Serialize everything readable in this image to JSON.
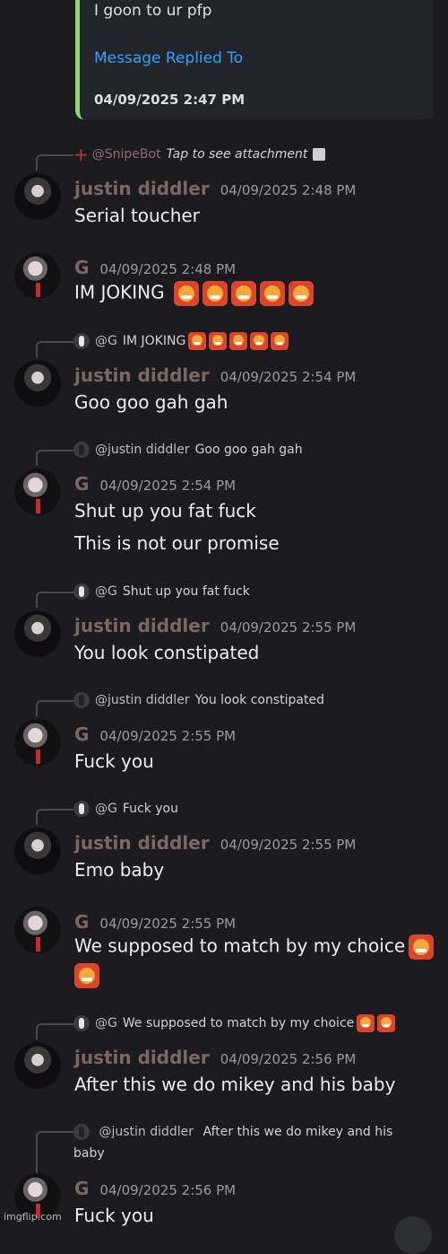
{
  "embed": {
    "text": "I goon to ur pfp",
    "link": "Message Replied To",
    "date": "04/09/2025 2:47 PM"
  },
  "messages": [
    {
      "reply": {
        "name": "@SnipeBot",
        "text": "Tap to see attachment"
      },
      "author": "justin diddler",
      "time": "04/09/2025 2:48 PM",
      "lines": [
        "Serial toucher"
      ]
    },
    {
      "author": "G",
      "time": "04/09/2025 2:48 PM",
      "lines": [
        "IM JOKING"
      ]
    },
    {
      "reply": {
        "name": "@G",
        "text": "IM JOKING"
      },
      "author": "justin diddler",
      "time": "04/09/2025 2:54 PM",
      "lines": [
        "Goo goo gah gah"
      ]
    },
    {
      "reply": {
        "name": "@justin diddler",
        "text": "Goo goo gah gah"
      },
      "author": "G",
      "time": "04/09/2025 2:54 PM",
      "lines": [
        "Shut up you fat fuck",
        "This is not our promise"
      ]
    },
    {
      "reply": {
        "name": "@G",
        "text": "Shut up you fat fuck"
      },
      "author": "justin diddler",
      "time": "04/09/2025 2:55 PM",
      "lines": [
        "You look constipated"
      ]
    },
    {
      "reply": {
        "name": "@justin diddler",
        "text": "You look constipated"
      },
      "author": "G",
      "time": "04/09/2025 2:55 PM",
      "lines": [
        "Fuck you"
      ]
    },
    {
      "reply": {
        "name": "@G",
        "text": "Fuck you"
      },
      "author": "justin diddler",
      "time": "04/09/2025 2:55 PM",
      "lines": [
        "Emo baby"
      ]
    },
    {
      "author": "G",
      "time": "04/09/2025 2:55 PM",
      "lines": [
        "We supposed to match by my choice"
      ]
    },
    {
      "reply": {
        "name": "@G",
        "text": "We supposed to match by my choice"
      },
      "author": "justin diddler",
      "time": "04/09/2025 2:56 PM",
      "lines": [
        "After this we do mikey and his baby"
      ]
    },
    {
      "reply": {
        "name": "@justin diddler",
        "text": "After this we do mikey and his baby"
      },
      "author": "G",
      "time": "04/09/2025 2:56 PM",
      "lines": [
        "Fuck you"
      ]
    }
  ],
  "watermark": "imgflip.com",
  "icons": {
    "reply_emoji": "angry-face-emoji",
    "attachment": "image-icon"
  },
  "colors": {
    "embed_bar": "#8ed672",
    "link": "#2aa5ff",
    "username": "#7d6861",
    "background": "#1b1b20"
  }
}
